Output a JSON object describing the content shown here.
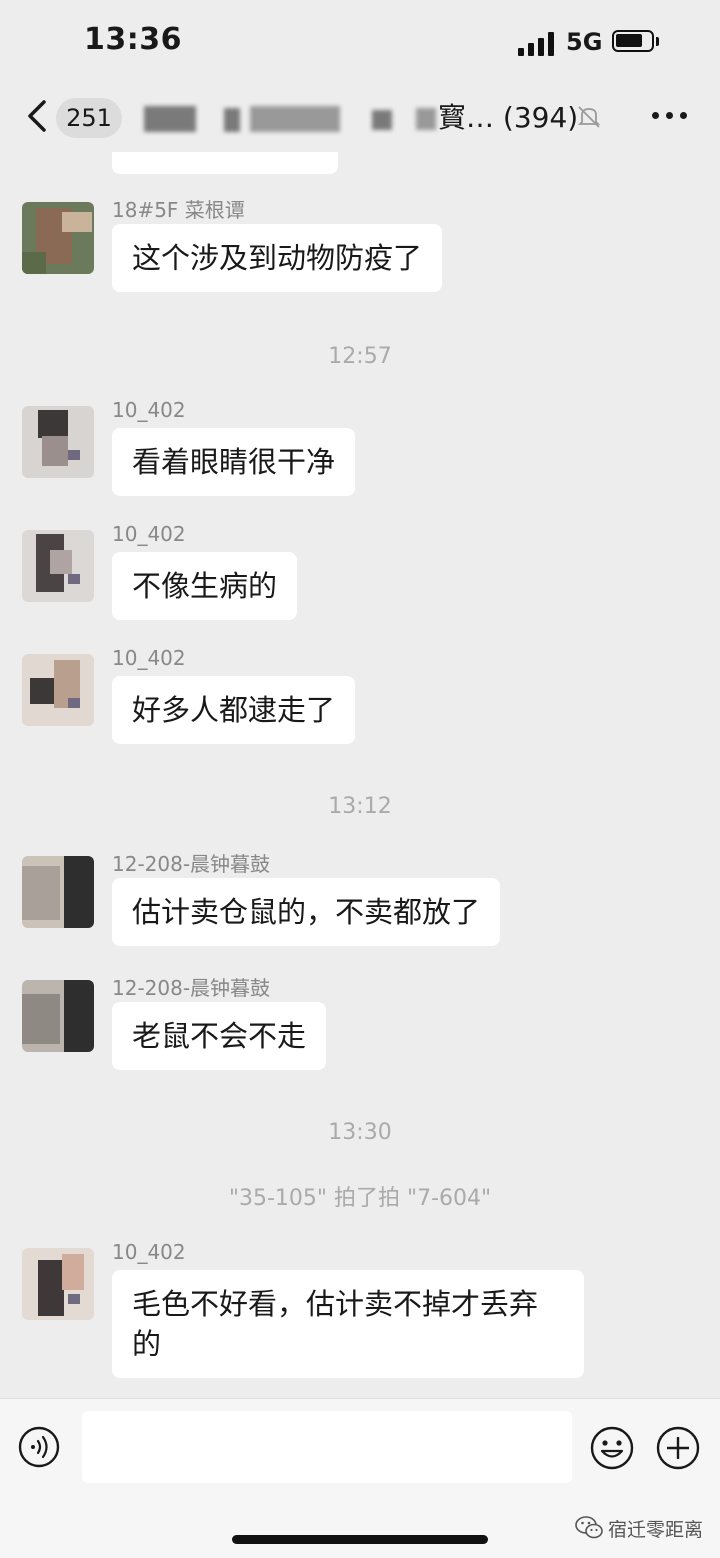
{
  "status_bar": {
    "time": "13:36",
    "network": "5G"
  },
  "nav": {
    "unread_count": "251",
    "title_visible": "寳… (394)"
  },
  "timestamps": [
    "12:57",
    "13:12",
    "13:30"
  ],
  "system_note": "\"35-105\" 拍了拍 \"7-604\"",
  "messages": [
    {
      "sender": "18#5F 菜根谭",
      "text": "这个涉及到动物防疫了"
    },
    {
      "sender": "10_402",
      "text": "看着眼睛很干净"
    },
    {
      "sender": "10_402",
      "text": "不像生病的"
    },
    {
      "sender": "10_402",
      "text": "好多人都逮走了"
    },
    {
      "sender": "12-208-晨钟暮鼓",
      "text": "估计卖仓鼠的，不卖都放了"
    },
    {
      "sender": "12-208-晨钟暮鼓",
      "text": "老鼠不会不走"
    },
    {
      "sender": "10_402",
      "text": "毛色不好看，估计卖不掉才丢弃的"
    }
  ],
  "input": {
    "placeholder": ""
  },
  "watermark": {
    "text": "宿迁零距离"
  },
  "icons": [
    "back-icon",
    "mute-icon",
    "more-icon",
    "voice-icon",
    "emoji-icon",
    "plus-icon",
    "wechat-logo-icon"
  ]
}
